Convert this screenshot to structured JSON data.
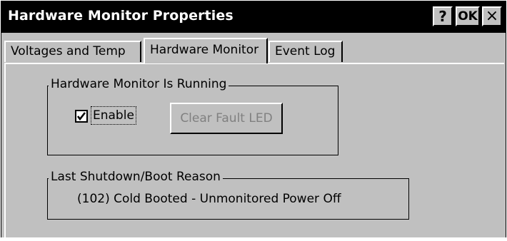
{
  "window": {
    "title": "Hardware Monitor Properties",
    "buttons": {
      "help": "?",
      "ok": "OK",
      "close": "×"
    }
  },
  "tabs": [
    {
      "label": "Voltages and Temp",
      "active": false
    },
    {
      "label": "Hardware Monitor",
      "active": true
    },
    {
      "label": "Event Log",
      "active": false
    }
  ],
  "status_group": {
    "legend": "Hardware Monitor Is Running",
    "enable_label": "Enable",
    "enable_checked": true,
    "clear_fault_label": "Clear Fault LED",
    "clear_fault_enabled": false
  },
  "shutdown_group": {
    "legend": "Last Shutdown/Boot Reason",
    "reason": "(102) Cold Booted - Unmonitored Power Off"
  },
  "colors": {
    "face": "#c0c0c0",
    "titlebar": "#000000",
    "disabled_text": "#808080"
  }
}
